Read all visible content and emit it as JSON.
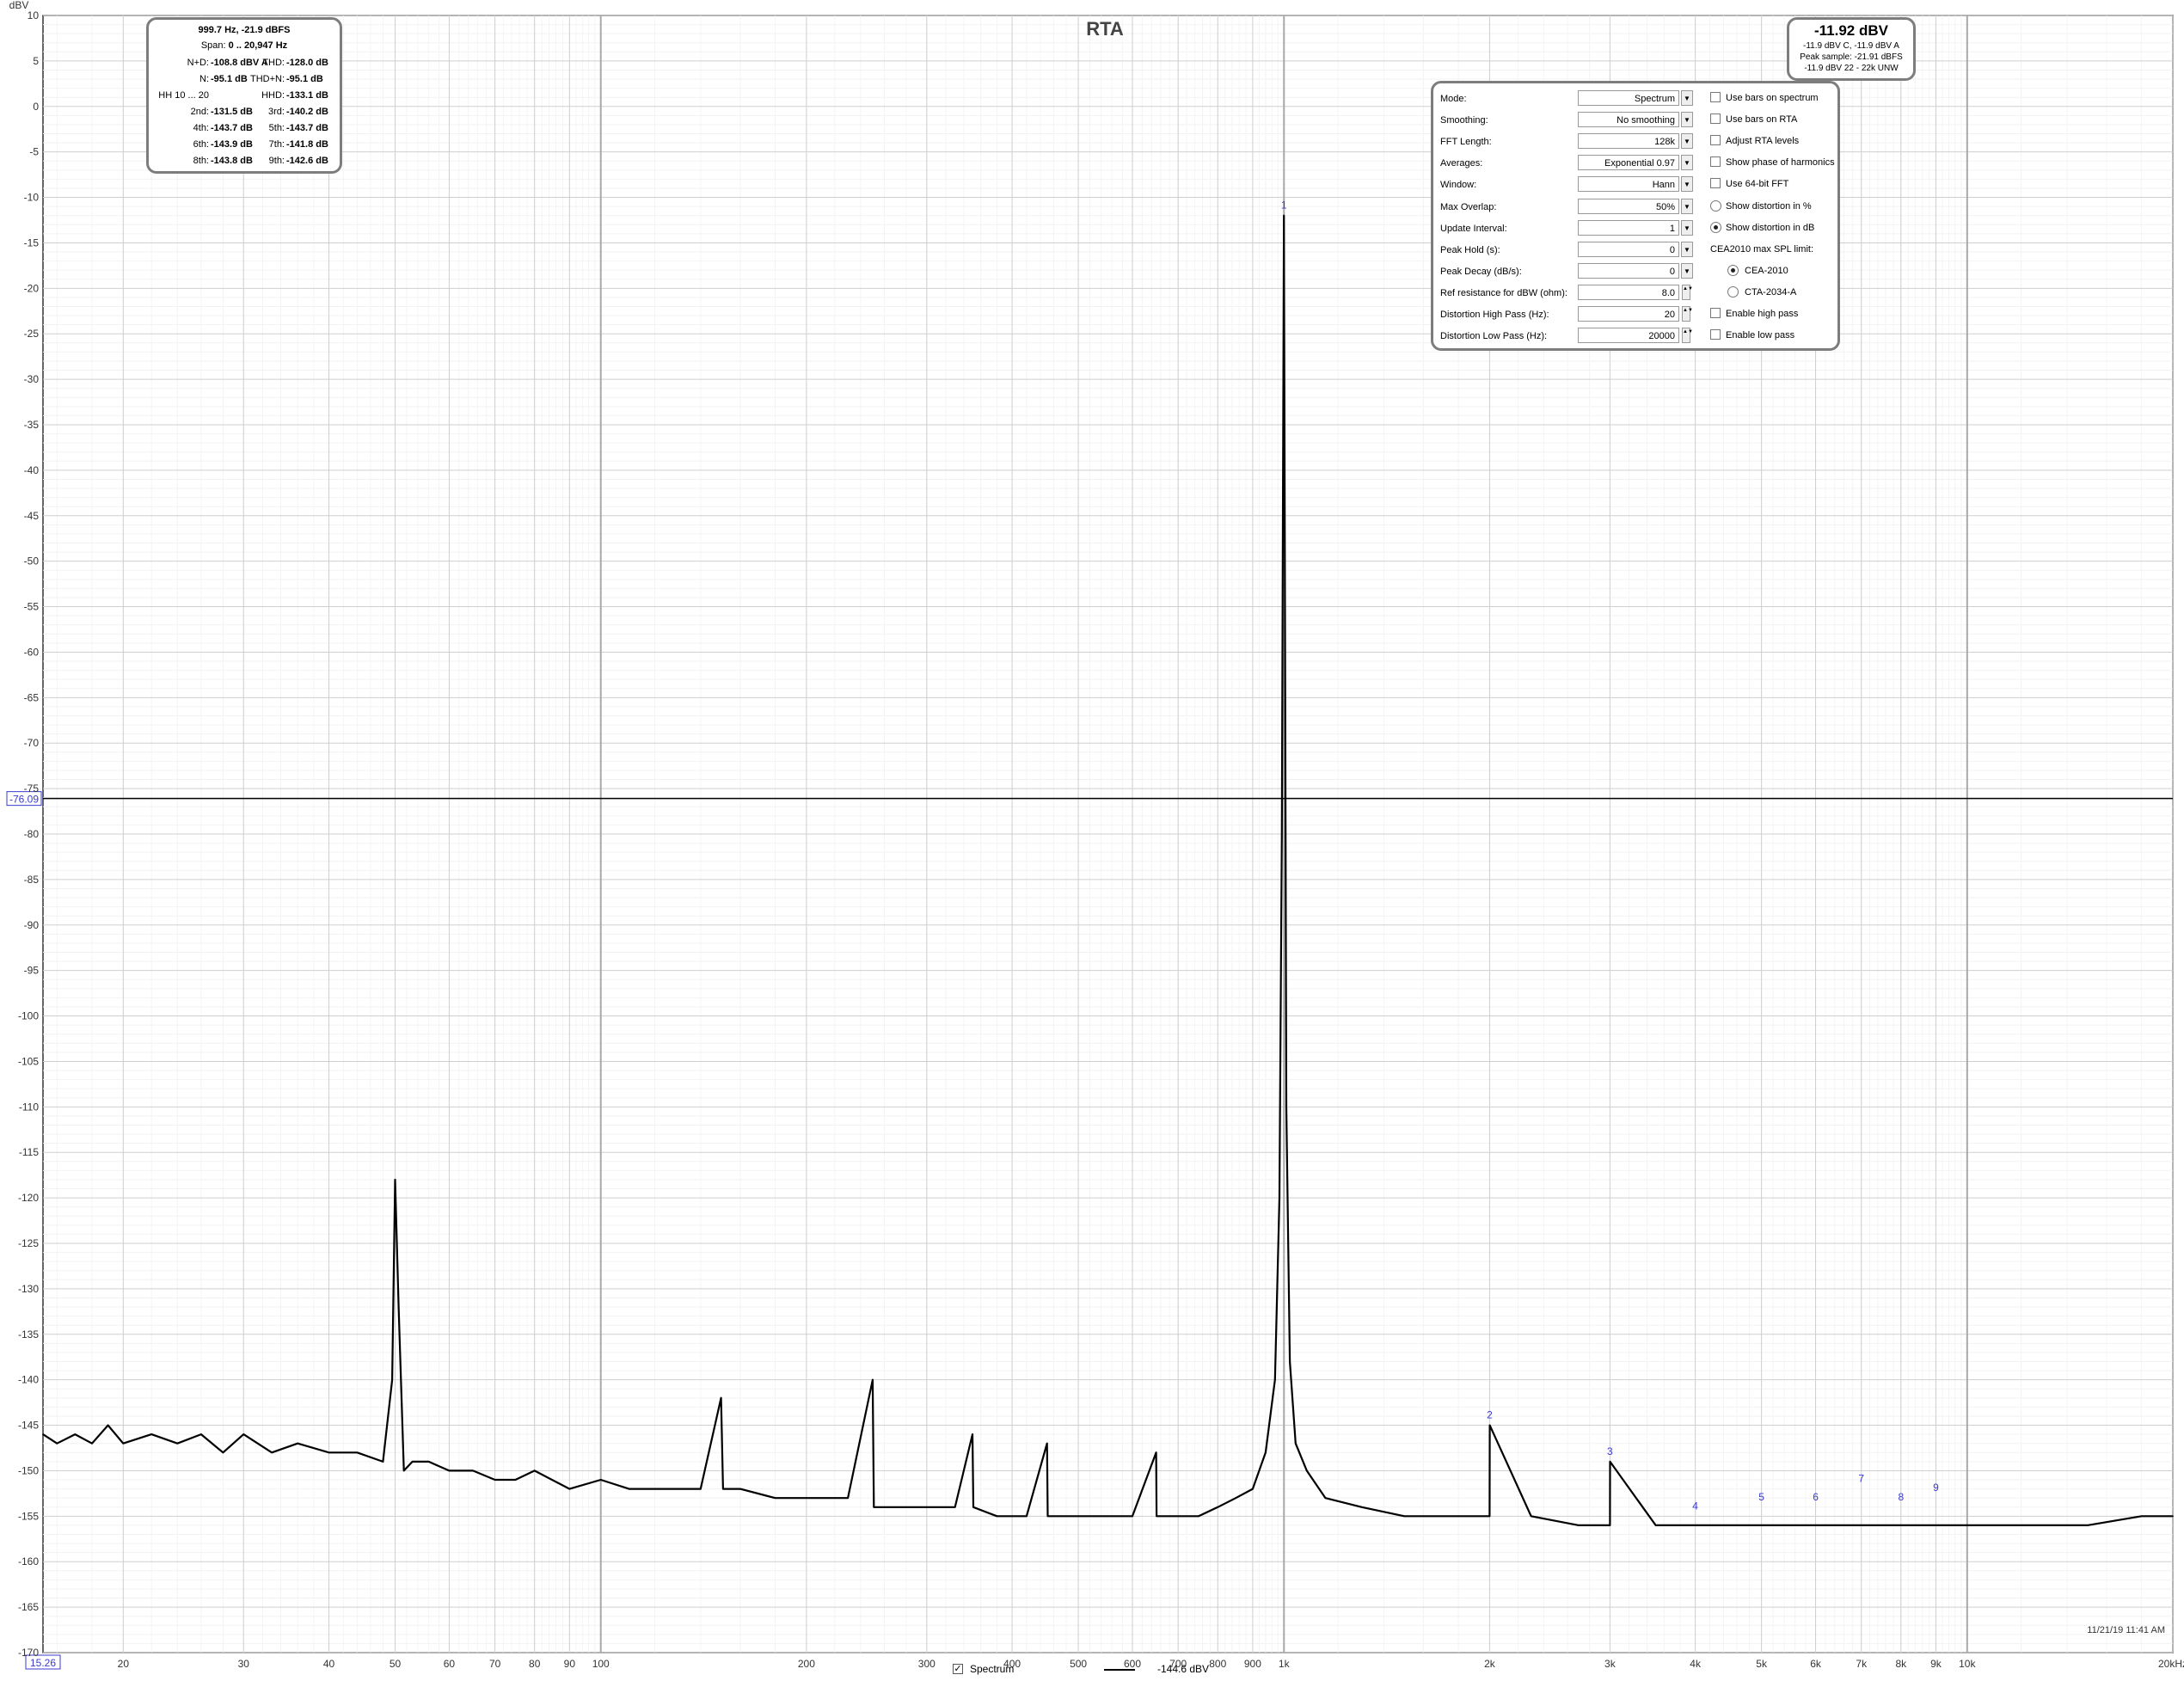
{
  "chart_data": {
    "type": "line",
    "title": "RTA",
    "ylabel": "dBV",
    "xunit": "kHz",
    "xscale": "log",
    "xlim": [
      15.26,
      20000
    ],
    "ylim": [
      -170,
      10
    ],
    "grid": true,
    "xticks": [
      20,
      30,
      40,
      50,
      60,
      70,
      80,
      90,
      100,
      200,
      300,
      400,
      500,
      600,
      700,
      800,
      900,
      1000,
      2000,
      3000,
      4000,
      5000,
      6000,
      7000,
      8000,
      9000,
      10000,
      20000
    ],
    "xtick_labels": [
      "20",
      "30",
      "40",
      "50",
      "60",
      "70",
      "80",
      "90",
      "100",
      "200",
      "300",
      "400",
      "500",
      "600",
      "700",
      "800",
      "900",
      "1k",
      "2k",
      "3k",
      "4k",
      "5k",
      "6k",
      "7k",
      "8k",
      "9k",
      "10k",
      "20kHz"
    ],
    "yticks": [
      10,
      5,
      0,
      -5,
      -10,
      -15,
      -20,
      -25,
      -30,
      -35,
      -40,
      -45,
      -50,
      -55,
      -60,
      -65,
      -70,
      -75,
      -80,
      -85,
      -90,
      -95,
      -100,
      -105,
      -110,
      -115,
      -120,
      -125,
      -130,
      -135,
      -140,
      -145,
      -150,
      -155,
      -160,
      -165,
      -170
    ],
    "cursor": {
      "y": -76.09,
      "y_label": "-76.09",
      "x_label": "15.26"
    },
    "series": [
      {
        "name": "Spectrum",
        "color": "#000000",
        "x": [
          15.26,
          16,
          17,
          18,
          19,
          20,
          22,
          24,
          26,
          28,
          30,
          33,
          36,
          40,
          44,
          48,
          49.5,
          50,
          50.6,
          51.5,
          53,
          56,
          60,
          65,
          70,
          75,
          80,
          90,
          100,
          110,
          120,
          140,
          150,
          151,
          160,
          180,
          200,
          230,
          250,
          251,
          270,
          300,
          330,
          350,
          351,
          380,
          420,
          450,
          451,
          500,
          550,
          600,
          650,
          651,
          700,
          750,
          800,
          850,
          900,
          940,
          970,
          985,
          993,
          997,
          999.7,
          1003,
          1008,
          1020,
          1040,
          1080,
          1150,
          1300,
          1500,
          1800,
          2000,
          2001,
          2300,
          2700,
          3000,
          3001,
          3500,
          4000,
          5000,
          6000,
          7000,
          8000,
          9000,
          10000,
          12000,
          15000,
          18000,
          20000
        ],
        "y": [
          -146,
          -147,
          -146,
          -147,
          -145,
          -147,
          -146,
          -147,
          -146,
          -148,
          -146,
          -148,
          -147,
          -148,
          -148,
          -149,
          -140,
          -118,
          -132,
          -150,
          -149,
          -149,
          -150,
          -150,
          -151,
          -151,
          -150,
          -152,
          -151,
          -152,
          -152,
          -152,
          -142,
          -152,
          -152,
          -153,
          -153,
          -153,
          -140,
          -154,
          -154,
          -154,
          -154,
          -146,
          -154,
          -155,
          -155,
          -147,
          -155,
          -155,
          -155,
          -155,
          -148,
          -155,
          -155,
          -155,
          -154,
          -153,
          -152,
          -148,
          -140,
          -120,
          -80,
          -40,
          -12,
          -50,
          -110,
          -138,
          -147,
          -150,
          -153,
          -154,
          -155,
          -155,
          -155,
          -145,
          -155,
          -156,
          -156,
          -149,
          -156,
          -156,
          -156,
          -156,
          -156,
          -156,
          -156,
          -156,
          -156,
          -156,
          -155,
          -155
        ]
      }
    ],
    "harmonic_markers": [
      {
        "label": "1",
        "x": 999.7,
        "y": -12
      },
      {
        "label": "2",
        "x": 2000,
        "y": -145
      },
      {
        "label": "3",
        "x": 3000,
        "y": -149
      },
      {
        "label": "4",
        "x": 4000,
        "y": -155
      },
      {
        "label": "5",
        "x": 5000,
        "y": -154
      },
      {
        "label": "6",
        "x": 6000,
        "y": -154
      },
      {
        "label": "7",
        "x": 7000,
        "y": -152
      },
      {
        "label": "8",
        "x": 8000,
        "y": -154
      },
      {
        "label": "9",
        "x": 9000,
        "y": -153
      }
    ]
  },
  "stats": {
    "line1": "999.7 Hz, -21.9 dBFS",
    "span_label": "Span:",
    "span_value": "0 .. 20,947 Hz",
    "rows": [
      {
        "l1": "N+D:",
        "v1": "-108.8 dBV A",
        "l2": "THD:",
        "v2": "-128.0 dB"
      },
      {
        "l1": "N:",
        "v1": "-95.1 dB",
        "l2": "THD+N:",
        "v2": "-95.1 dB"
      },
      {
        "l1": "HH 10 ... 20",
        "v1": "",
        "l2": "HHD:",
        "v2": "-133.1 dB"
      },
      {
        "l1": "2nd:",
        "v1": "-131.5 dB",
        "l2": "3rd:",
        "v2": "-140.2 dB"
      },
      {
        "l1": "4th:",
        "v1": "-143.7 dB",
        "l2": "5th:",
        "v2": "-143.7 dB"
      },
      {
        "l1": "6th:",
        "v1": "-143.9 dB",
        "l2": "7th:",
        "v2": "-141.8 dB"
      },
      {
        "l1": "8th:",
        "v1": "-143.8 dB",
        "l2": "9th:",
        "v2": "-142.6 dB"
      }
    ]
  },
  "level": {
    "value": "-11.92 dBV",
    "line1": "-11.9 dBV C, -11.9 dBV A",
    "line2": "Peak sample: -21.91 dBFS",
    "line3": "-11.9 dBV 22 - 22k UNW"
  },
  "panel": {
    "rows": [
      {
        "label": "Mode:",
        "value": "Spectrum",
        "control": "dropdown"
      },
      {
        "label": "Smoothing:",
        "value": "No  smoothing",
        "control": "dropdown"
      },
      {
        "label": "FFT Length:",
        "value": "128k",
        "control": "dropdown"
      },
      {
        "label": "Averages:",
        "value": "Exponential 0.97",
        "control": "dropdown"
      },
      {
        "label": "Window:",
        "value": "Hann",
        "control": "dropdown"
      },
      {
        "label": "Max Overlap:",
        "value": "50%",
        "control": "dropdown"
      },
      {
        "label": "Update Interval:",
        "value": "1",
        "control": "dropdown"
      },
      {
        "label": "Peak Hold (s):",
        "value": "0",
        "control": "dropdown"
      },
      {
        "label": "Peak Decay (dB/s):",
        "value": "0",
        "control": "dropdown"
      },
      {
        "label": "Ref resistance for dBW (ohm):",
        "value": "8.0",
        "control": "spinner"
      },
      {
        "label": "Distortion High Pass (Hz):",
        "value": "20",
        "control": "spinner"
      },
      {
        "label": "Distortion Low Pass (Hz):",
        "value": "20000",
        "control": "spinner"
      }
    ],
    "options": [
      {
        "label": "Use bars on spectrum",
        "kind": "checkbox",
        "checked": false
      },
      {
        "label": "Use bars on RTA",
        "kind": "checkbox",
        "checked": false
      },
      {
        "label": "Adjust RTA levels",
        "kind": "checkbox",
        "checked": false
      },
      {
        "label": "Show phase of harmonics",
        "kind": "checkbox",
        "checked": false
      },
      {
        "label": "Use 64-bit FFT",
        "kind": "checkbox",
        "checked": false
      },
      {
        "label": "Show distortion in %",
        "kind": "radio",
        "checked": false
      },
      {
        "label": "Show distortion in dB",
        "kind": "radio",
        "checked": true
      },
      {
        "label": "CEA2010 max SPL limit:",
        "kind": "heading",
        "checked": false
      },
      {
        "label": "CEA-2010",
        "kind": "radio-indent",
        "checked": true
      },
      {
        "label": "CTA-2034-A",
        "kind": "radio-indent",
        "checked": false
      },
      {
        "label": "Enable high pass",
        "kind": "checkbox",
        "checked": false
      },
      {
        "label": "Enable low pass",
        "kind": "checkbox",
        "checked": false
      }
    ]
  },
  "legend": {
    "checkmark": "✓",
    "name": "Spectrum",
    "value": "-144.6 dBV"
  },
  "timestamp": "11/21/19 11:41 AM"
}
